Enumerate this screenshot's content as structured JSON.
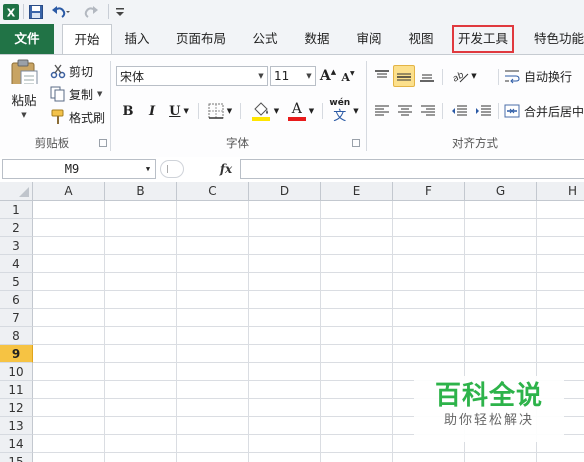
{
  "quick_access": {
    "excel_icon": "excel-logo-icon",
    "save_icon": "save-icon",
    "undo_icon": "undo-icon",
    "redo_icon": "redo-icon",
    "customize_icon": "customize-qat-icon"
  },
  "tabs": [
    {
      "label": "文件"
    },
    {
      "label": "开始"
    },
    {
      "label": "插入"
    },
    {
      "label": "页面布局"
    },
    {
      "label": "公式"
    },
    {
      "label": "数据"
    },
    {
      "label": "审阅"
    },
    {
      "label": "视图"
    },
    {
      "label": "开发工具"
    },
    {
      "label": "特色功能"
    }
  ],
  "active_tab": "开始",
  "highlighted_tab": "开发工具",
  "clipboard": {
    "paste": "粘贴",
    "cut": "剪切",
    "copy": "复制",
    "format_painter": "格式刷",
    "group_label": "剪贴板"
  },
  "font": {
    "name": "宋体",
    "size": "11",
    "bold": "B",
    "italic": "I",
    "underline": "U",
    "grow": "A",
    "shrink": "A",
    "font_color": "A",
    "phonetic": "wén",
    "phonetic_char": "文",
    "group_label": "字体"
  },
  "alignment": {
    "wrap_text": "自动换行",
    "merge_center": "合并后居中",
    "group_label": "对齐方式"
  },
  "name_box": "M9",
  "fx_label": "fx",
  "formula": "",
  "columns": [
    "A",
    "B",
    "C",
    "D",
    "E",
    "F",
    "G",
    "H"
  ],
  "rows": [
    "1",
    "2",
    "3",
    "4",
    "5",
    "6",
    "7",
    "8",
    "9",
    "10",
    "11",
    "12",
    "13",
    "14",
    "15"
  ],
  "selected_row": "9",
  "watermark": {
    "title": "百科全说",
    "subtitle": "助你轻松解决"
  },
  "colors": {
    "file_tab": "#217346",
    "highlight_box": "#e0393e",
    "selected_row": "#f6c343",
    "watermark_green": "#2db34a"
  }
}
